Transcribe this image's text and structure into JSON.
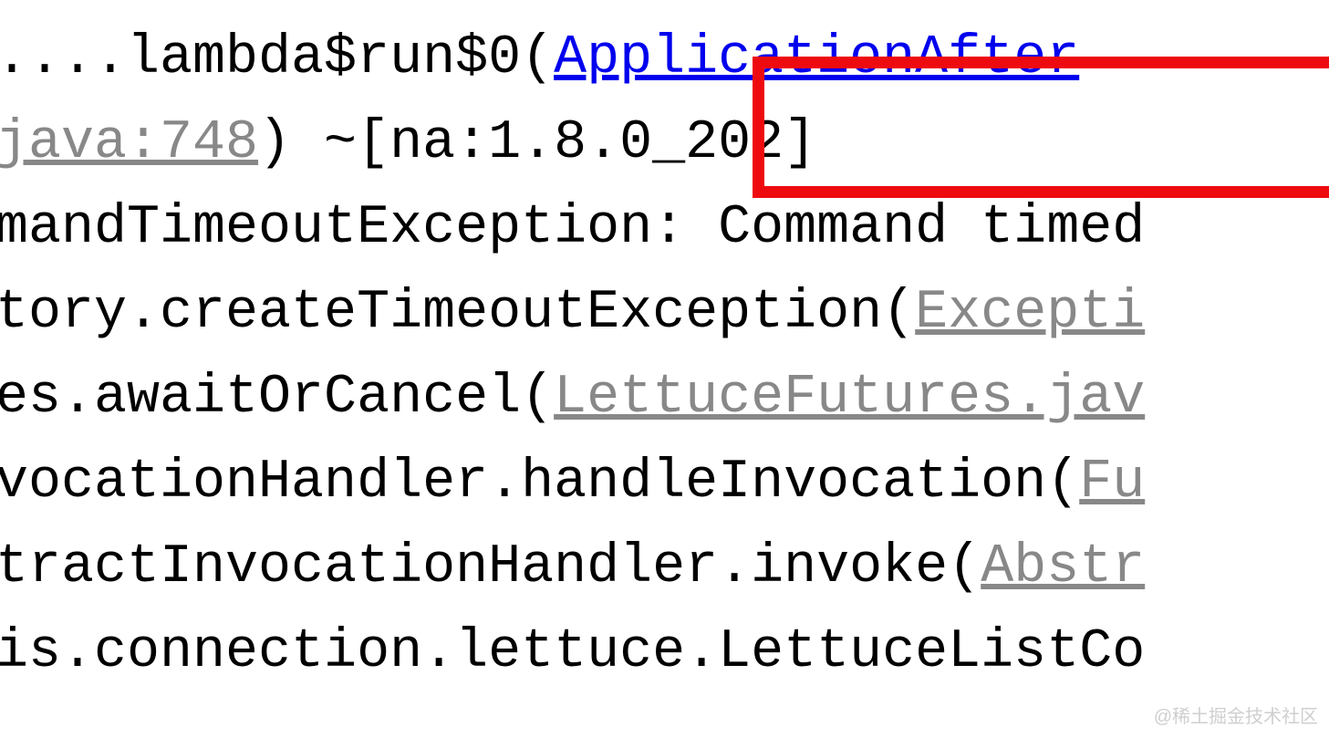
{
  "stacktrace": {
    "line0_prefix": "....lambda$run$0(",
    "line0_link": "ApplicationAfter",
    "line1_link": "java:748",
    "line1_suffix": ") ~[na:1.8.0_202]",
    "line2": "mandTimeoutException: Command timed",
    "line3_prefix": "tory.createTimeoutException(",
    "line3_link": "Excepti",
    "line4_prefix": "es.awaitOrCancel(",
    "line4_link": "LettuceFutures.jav",
    "line5_prefix": "vocationHandler.handleInvocation(",
    "line5_link": "Fu",
    "line6_prefix": "tractInvocationHandler.invoke(",
    "line6_link": "Abstr",
    "line7": "is.connection.lettuce.LettuceListCo"
  },
  "watermark": "@稀土掘金技术社区",
  "colors": {
    "highlight": "#ee0b10",
    "link_blue": "#0000ee",
    "link_gray": "#888888"
  }
}
